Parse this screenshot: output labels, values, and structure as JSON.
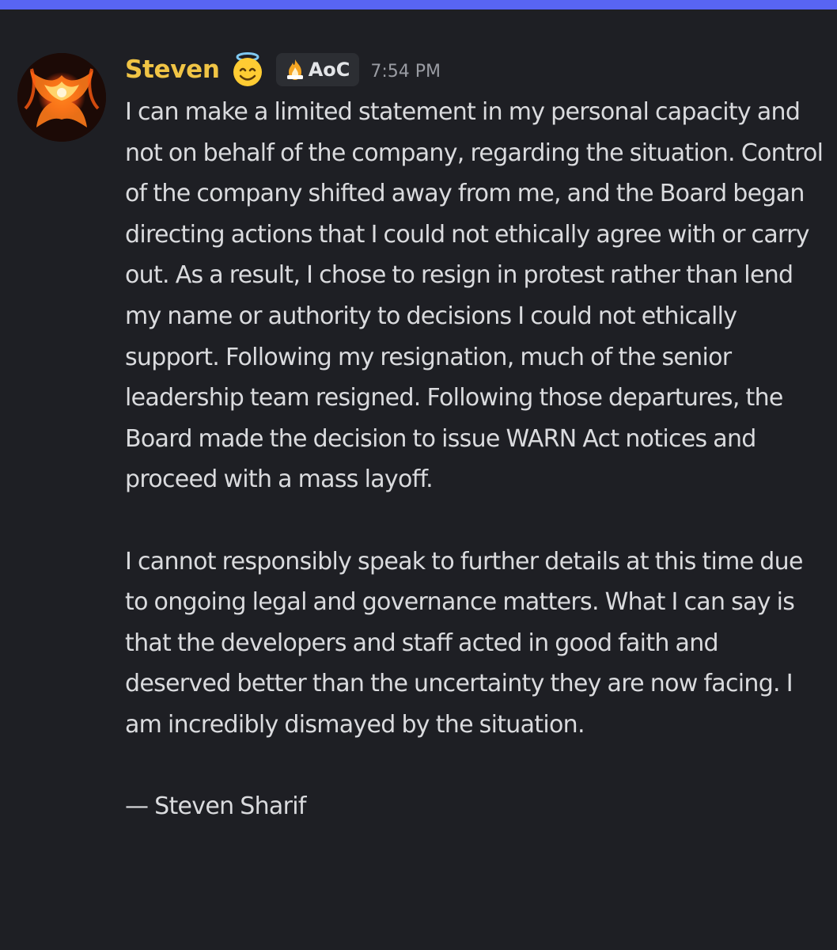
{
  "message": {
    "username": "Steven",
    "emoji": "smiling-face-with-halo-emoji",
    "tag": {
      "icon": "flame-crown-icon",
      "label": "AoC"
    },
    "timestamp": "7:54 PM",
    "paragraphs": [
      "I can make a limited statement in my personal capacity and not on behalf of the company, regarding the situation. Control of the company shifted away from me, and the Board began directing actions that I could not ethically agree with or carry out. As a result, I chose to resign in protest rather than lend my name or authority to decisions I could not ethically support. Following my resignation, much of the senior leadership team resigned. Following those departures, the Board made the decision to issue WARN Act notices and proceed with a mass layoff.",
      "I cannot responsibly speak to further details at this time due to ongoing legal and governance matters. What I can say is that the developers and staff acted in good faith and deserved better than the uncertainty they are now facing. I am incredibly dismayed by the situation.",
      "— Steven Sharif"
    ]
  },
  "colors": {
    "background": "#1e1f24",
    "accent_bar": "#5865f2",
    "username": "#f0c445",
    "text": "#dadbde",
    "timestamp": "#9a9ca3",
    "tag_background": "#2c2e33"
  }
}
